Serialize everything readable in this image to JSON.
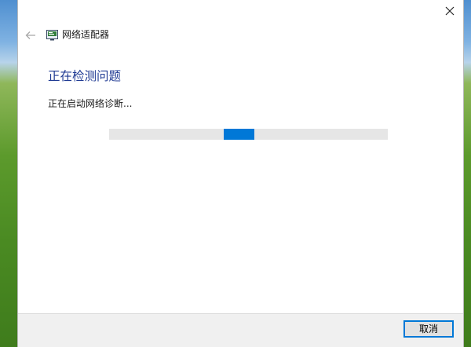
{
  "window": {
    "app_title": "网络适配器",
    "app_icon": "network-adapter-icon",
    "close_icon": "close-icon",
    "back_icon": "back-arrow-icon"
  },
  "main": {
    "heading": "正在检测问题",
    "status_text": "正在启动网络诊断..."
  },
  "progress": {
    "type": "indeterminate",
    "segment_start_fraction": 0.41,
    "segment_end_fraction": 0.52,
    "colors": {
      "track": "#e6e6e6",
      "fill": "#0078d7"
    }
  },
  "footer": {
    "cancel_label": "取消"
  },
  "colors": {
    "heading": "#1f3a93",
    "accent": "#0078d7"
  }
}
